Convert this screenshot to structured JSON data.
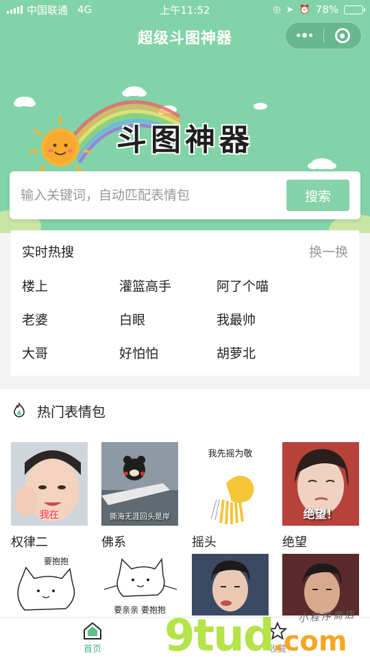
{
  "status_bar": {
    "carrier": "中国联通",
    "network": "4G",
    "time": "上午11:52",
    "battery": "78%",
    "battery_level": 0.78
  },
  "header": {
    "title": "超级斗图神器",
    "banner_text": "斗图神器",
    "capsule_icons": [
      "more-dots-icon",
      "close-target-icon"
    ]
  },
  "search": {
    "placeholder": "输入关键词，自动匹配表情包",
    "button": "搜索"
  },
  "hot_search": {
    "title": "实时热搜",
    "refresh": "换一换",
    "items": [
      "楼上",
      "灌篮高手",
      "阿了个喵",
      "老婆",
      "白眼",
      "我最帅",
      "大哥",
      "好怕怕",
      "胡萝北"
    ]
  },
  "popular": {
    "title": "热门表情包",
    "row1": [
      {
        "label": "权律二",
        "caption": "我在"
      },
      {
        "label": "佛系",
        "caption": "撕海无涯回头是岸"
      },
      {
        "label": "摇头",
        "caption": "我先摇为敬"
      },
      {
        "label": "绝望",
        "caption": "绝望！"
      }
    ],
    "row2": [
      {
        "caption": "要抱抱"
      },
      {
        "caption": "要亲亲  要抱抱"
      },
      {
        "caption": ""
      },
      {
        "caption": ""
      }
    ]
  },
  "tabbar": {
    "items": [
      {
        "label": "首页",
        "icon": "home-icon",
        "active": true
      },
      {
        "label": "收藏",
        "icon": "star-icon",
        "active": false
      }
    ]
  },
  "watermark": {
    "brand": "9tud",
    "suffix": ".com",
    "tagline": "小程序商店"
  },
  "colors": {
    "header_bg": "#83d3a8",
    "accent": "#86d3a9",
    "active_tab": "#49b27e"
  }
}
